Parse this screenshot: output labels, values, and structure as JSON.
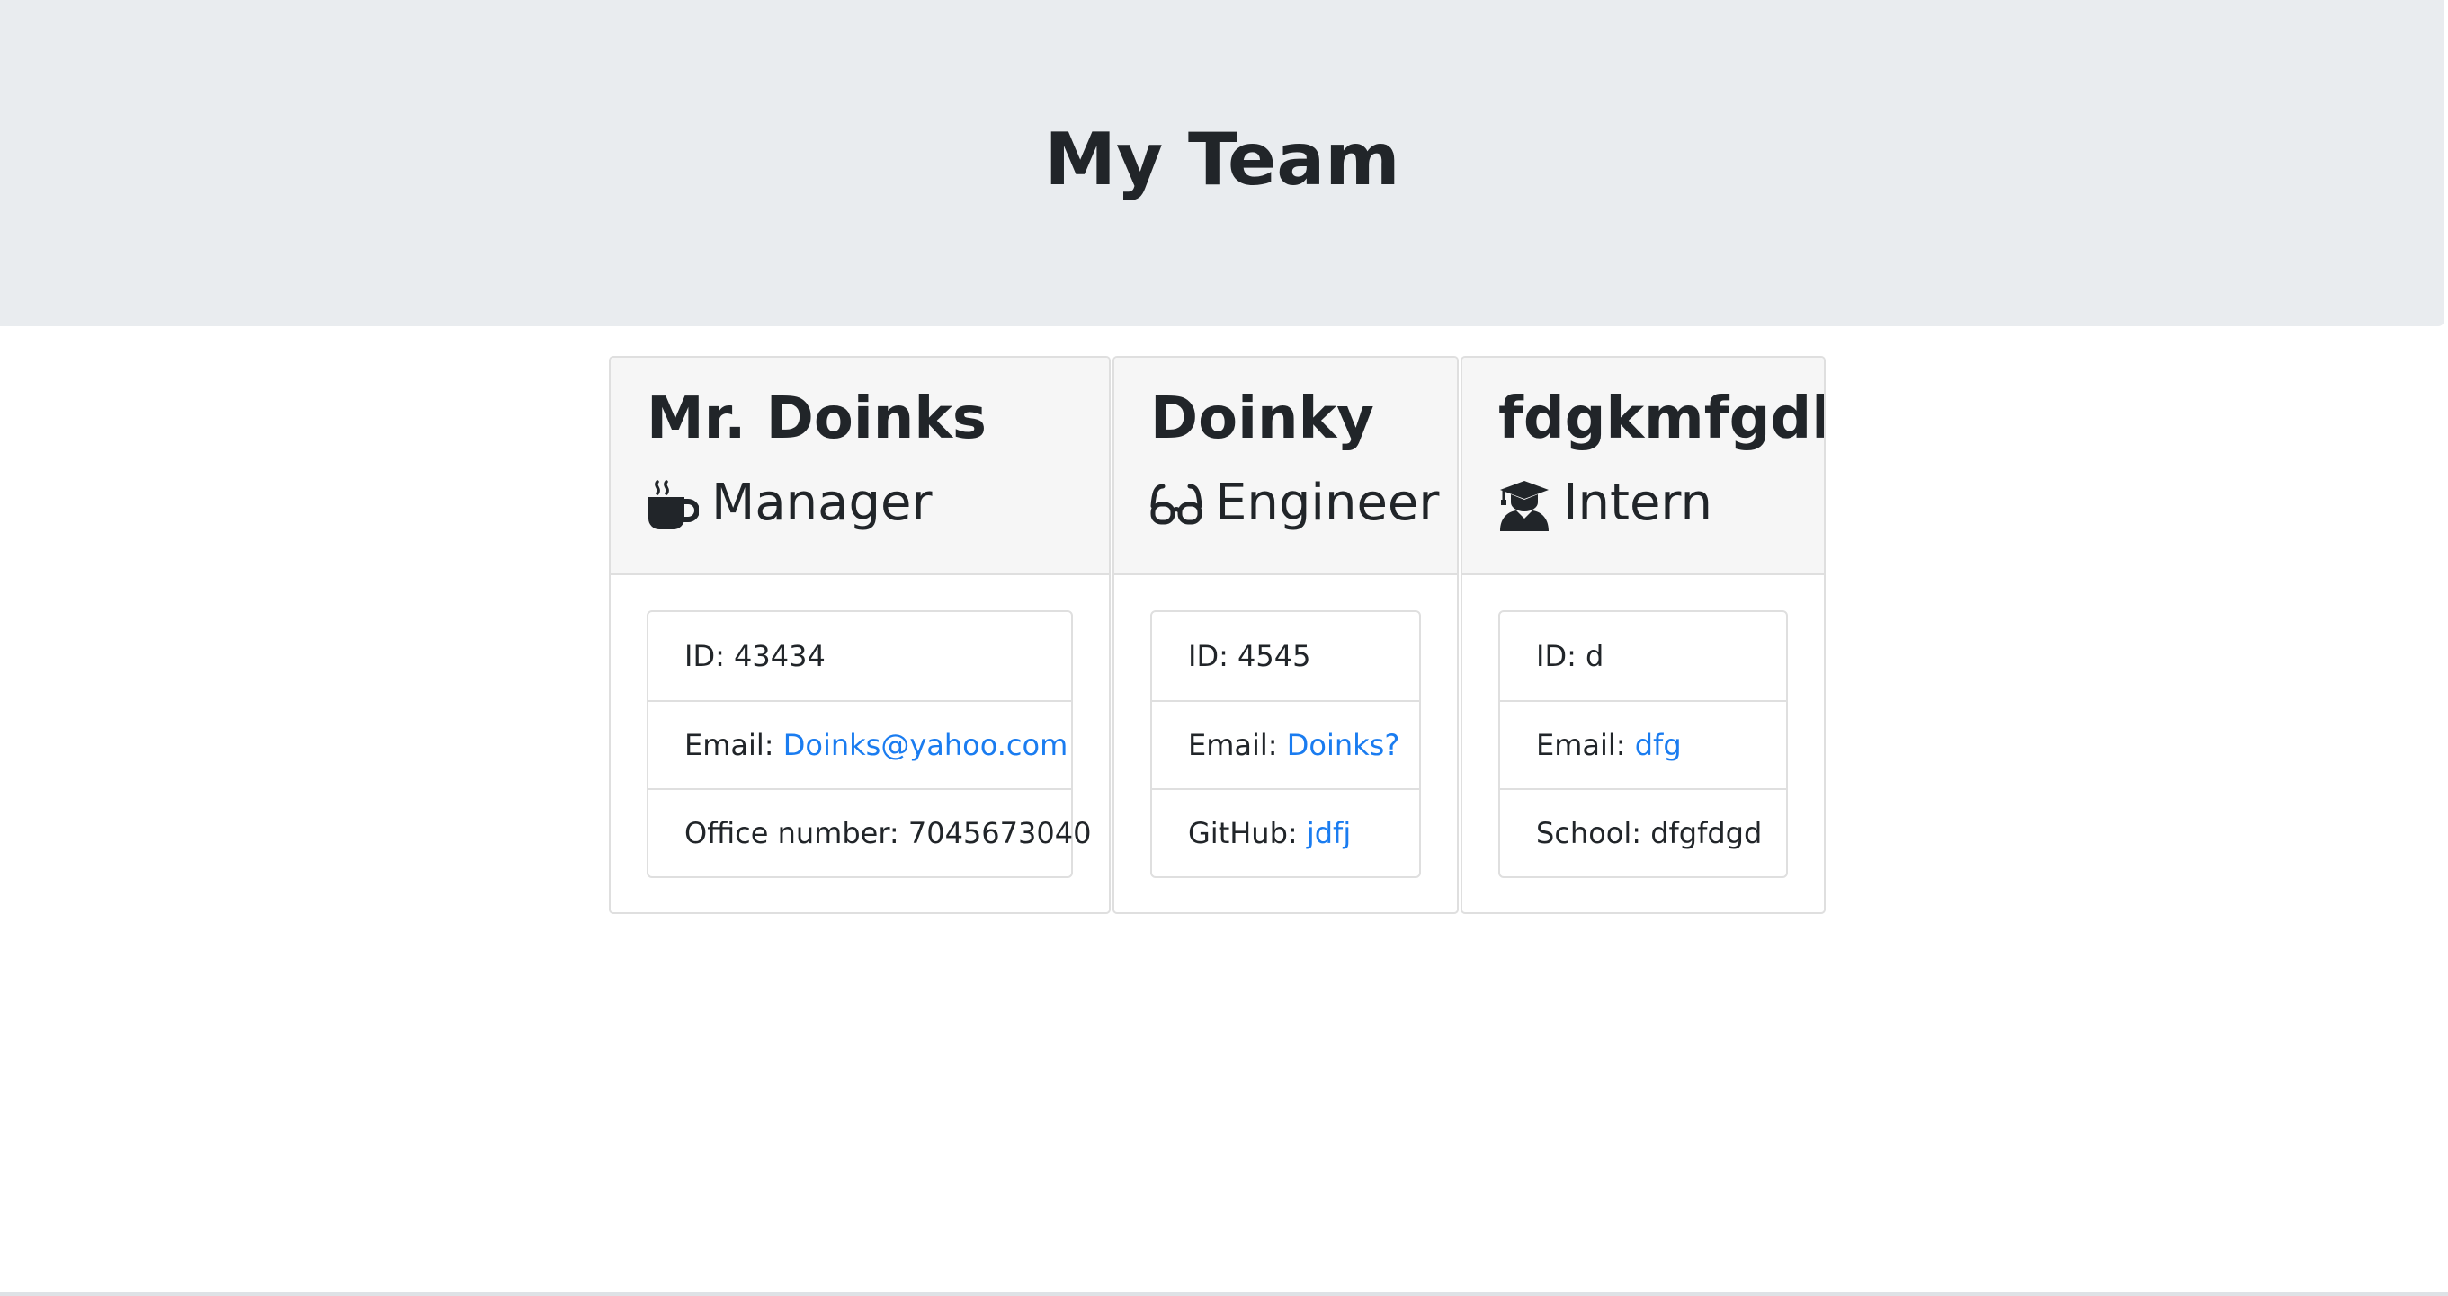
{
  "header": {
    "title": "My Team"
  },
  "team": [
    {
      "name": "Mr. Doinks",
      "role": "Manager",
      "role_icon": "coffee-mug-icon",
      "details": [
        {
          "label": "ID:",
          "value": "43434",
          "is_link": false
        },
        {
          "label": "Email:",
          "value": "Doinks@yahoo.com",
          "is_link": true
        },
        {
          "label": "Office number:",
          "value": "7045673040",
          "is_link": false
        }
      ]
    },
    {
      "name": "Doinky",
      "role": "Engineer",
      "role_icon": "glasses-icon",
      "details": [
        {
          "label": "ID:",
          "value": "4545",
          "is_link": false
        },
        {
          "label": "Email:",
          "value": "Doinks?",
          "is_link": true
        },
        {
          "label": "GitHub:",
          "value": "jdfj",
          "is_link": true
        }
      ]
    },
    {
      "name": "fdgkmfgdk",
      "role": "Intern",
      "role_icon": "graduate-icon",
      "details": [
        {
          "label": "ID:",
          "value": "d",
          "is_link": false
        },
        {
          "label": "Email:",
          "value": "dfg",
          "is_link": true
        },
        {
          "label": "School:",
          "value": "dfgfdgd",
          "is_link": false
        }
      ]
    }
  ],
  "colors": {
    "header_bg": "#e9ecef",
    "card_header_bg": "#f6f6f6",
    "link": "#1a7cf0",
    "text": "#212529"
  }
}
